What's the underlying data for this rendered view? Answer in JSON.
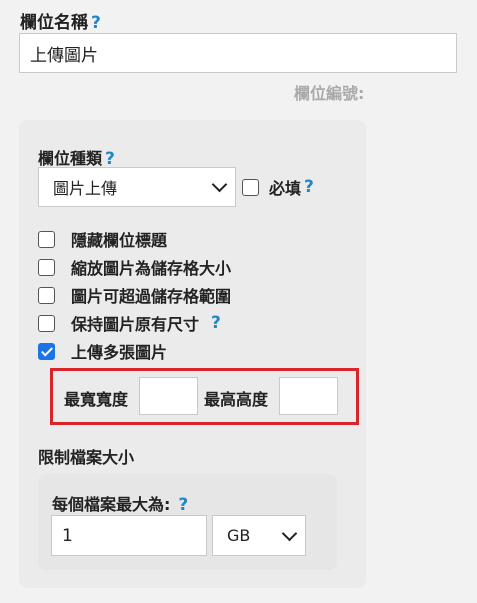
{
  "field_name": {
    "label": "欄位名稱",
    "help": "?",
    "value": "上傳圖片"
  },
  "field_number_label": "欄位編號:",
  "field_type": {
    "label": "欄位種類",
    "help": "?",
    "selected": "圖片上傳"
  },
  "required": {
    "label": "必填",
    "help": "?",
    "checked": false
  },
  "options": [
    {
      "label": "隱藏欄位標題",
      "checked": false
    },
    {
      "label": "縮放圖片為儲存格大小",
      "checked": false
    },
    {
      "label": "圖片可超過儲存格範圍",
      "checked": false
    },
    {
      "label": "保持圖片原有尺寸",
      "checked": false,
      "help": "?"
    },
    {
      "label": "上傳多張圖片",
      "checked": true
    }
  ],
  "dimensions": {
    "max_width_label": "最寬寬度",
    "max_width_value": "",
    "max_height_label": "最高高度",
    "max_height_value": ""
  },
  "file_size": {
    "section_label": "限制檔案大小",
    "per_file_label": "每個檔案最大為:",
    "help": "?",
    "value": "1",
    "unit": "GB"
  },
  "colors": {
    "help_blue": "#1e88c7",
    "highlight_red": "#d9242a",
    "check_blue": "#1a73e8"
  }
}
